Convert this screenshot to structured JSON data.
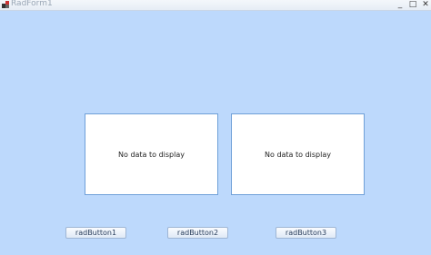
{
  "window": {
    "title": "RadForm1",
    "controls": {
      "minimize": "_",
      "maximize": "□",
      "close": "✕"
    }
  },
  "panels": [
    {
      "empty_text": "No data to display"
    },
    {
      "empty_text": "No data to display"
    }
  ],
  "buttons": [
    {
      "label": "radButton1"
    },
    {
      "label": "radButton2"
    },
    {
      "label": "radButton3"
    }
  ],
  "colors": {
    "form_background": "#bdd9fc",
    "panel_border": "#6fa0d8",
    "panel_background": "#ffffff"
  }
}
